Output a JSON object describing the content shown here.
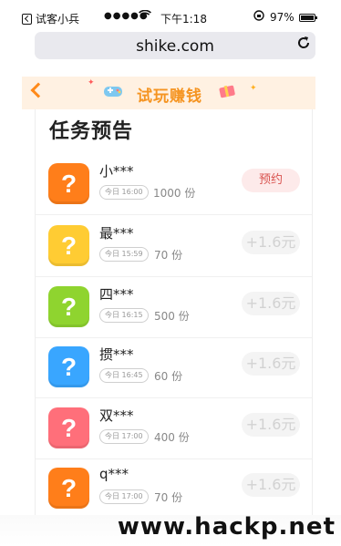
{
  "status_bar": {
    "back_app": "试客小兵",
    "signal": "●●●●●",
    "time": "下午1:18",
    "battery": "97%"
  },
  "browser": {
    "url": "shike.com"
  },
  "header": {
    "title": "试玩赚钱"
  },
  "section_title": "任务预告",
  "tasks": [
    {
      "name": "小***",
      "time": "今日 16:00",
      "count": "1000 份",
      "action": "预约",
      "icon_color": "#ff7e1a"
    },
    {
      "name": "最***",
      "time": "今日 15:59",
      "count": "70 份",
      "action": "+1.6元",
      "icon_color": "#ffcc33"
    },
    {
      "name": "四***",
      "time": "今日 16:15",
      "count": "500 份",
      "action": "+1.6元",
      "icon_color": "#8fd42f"
    },
    {
      "name": "掼***",
      "time": "今日 16:45",
      "count": "60 份",
      "action": "+1.6元",
      "icon_color": "#39a6ff"
    },
    {
      "name": "双***",
      "time": "今日 17:00",
      "count": "400 份",
      "action": "+1.6元",
      "icon_color": "#ff6f7a"
    },
    {
      "name": "q***",
      "time": "今日 17:00",
      "count": "70 份",
      "action": "+1.6元",
      "icon_color": "#ff7e1a"
    }
  ],
  "icon_glyph": "?",
  "watermark": "www.hackp.net"
}
